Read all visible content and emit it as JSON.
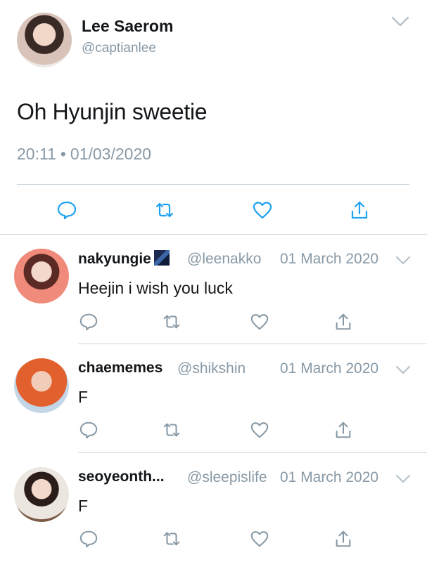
{
  "tweet": {
    "author_name": "Lee Saerom",
    "author_handle": "@captianlee",
    "text": "Oh Hyunjin sweetie",
    "time": "20:11",
    "separator": "•",
    "date": "01/03/2020"
  },
  "icons": {
    "reply": "reply-icon",
    "retweet": "retweet-icon",
    "like": "heart-icon",
    "share": "share-icon",
    "menu": "chevron-down-icon"
  },
  "colors": {
    "accent": "#1da1f2",
    "muted": "#8899a6",
    "divider": "#ccd6dd"
  },
  "replies": [
    {
      "name": "nakyungie",
      "handle": "@leenakko",
      "date": "01 March 2020",
      "text": "Heejin i wish you luck"
    },
    {
      "name": "chaememes",
      "handle": "@shikshin",
      "date": "01 March 2020",
      "text": "F"
    },
    {
      "name": "seoyeonth...",
      "handle": "@sleepislife",
      "date": "01 March 2020",
      "text": "F"
    }
  ]
}
